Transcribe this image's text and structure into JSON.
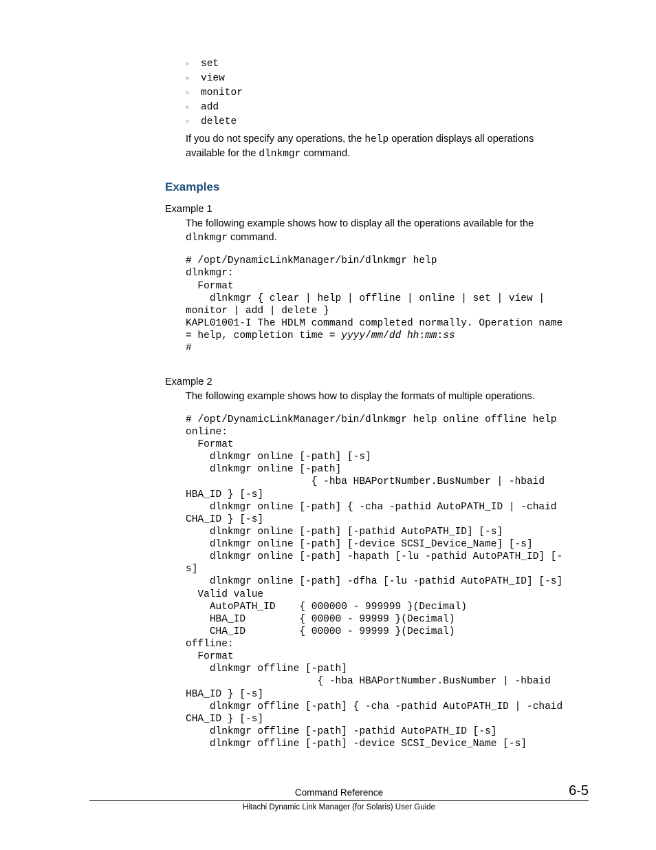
{
  "ops": [
    "set",
    "view",
    "monitor",
    "add",
    "delete"
  ],
  "intro": {
    "part1": "If you do not specify any operations, the ",
    "help": "help",
    "part2": " operation displays all operations available for the ",
    "cmd": "dlnkmgr",
    "part3": " command."
  },
  "section_heading": "Examples",
  "example1": {
    "label": "Example 1",
    "desc_part1": "The following example shows how to display all the operations available for the ",
    "desc_cmd": "dlnkmgr",
    "desc_part2": " command.",
    "code_pre": "# /opt/DynamicLinkManager/bin/dlnkmgr help\ndlnkmgr:\n  Format\n    dlnkmgr { clear | help | offline | online | set | view | monitor | add | delete }\nKAPL01001-I The HDLM command completed normally. Operation name = help, completion time = ",
    "code_vars": "yyyy",
    "slash1": "/",
    "code_mm1": "mm",
    "slash2": "/",
    "code_dd": "dd",
    "space1": " ",
    "code_hh": "hh",
    "colon1": ":",
    "code_mm2": "mm",
    "colon2": ":",
    "code_ss": "ss",
    "code_post": "\n#"
  },
  "example2": {
    "label": "Example 2",
    "desc": "The following example shows how to display the formats of multiple operations.",
    "code": "# /opt/DynamicLinkManager/bin/dlnkmgr help online offline help\nonline:\n  Format\n    dlnkmgr online [-path] [-s]\n    dlnkmgr online [-path]\n                     { -hba HBAPortNumber.BusNumber | -hbaid HBA_ID } [-s]\n    dlnkmgr online [-path] { -cha -pathid AutoPATH_ID | -chaid CHA_ID } [-s]\n    dlnkmgr online [-path] [-pathid AutoPATH_ID] [-s]\n    dlnkmgr online [-path] [-device SCSI_Device_Name] [-s]\n    dlnkmgr online [-path] -hapath [-lu -pathid AutoPATH_ID] [-s]\n    dlnkmgr online [-path] -dfha [-lu -pathid AutoPATH_ID] [-s]\n  Valid value\n    AutoPATH_ID    { 000000 - 999999 }(Decimal)\n    HBA_ID         { 00000 - 99999 }(Decimal)\n    CHA_ID         { 00000 - 99999 }(Decimal)\noffline:\n  Format\n    dlnkmgr offline [-path]\n                      { -hba HBAPortNumber.BusNumber | -hbaid HBA_ID } [-s]\n    dlnkmgr offline [-path] { -cha -pathid AutoPATH_ID | -chaid CHA_ID } [-s]\n    dlnkmgr offline [-path] -pathid AutoPATH_ID [-s]\n    dlnkmgr offline [-path] -device SCSI_Device_Name [-s]"
  },
  "footer": {
    "title": "Command Reference",
    "page": "6-5",
    "sub": "Hitachi Dynamic Link Manager (for Solaris) User Guide"
  }
}
